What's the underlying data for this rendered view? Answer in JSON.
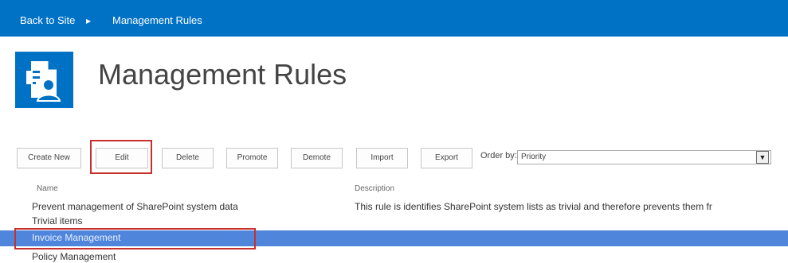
{
  "breadcrumb": {
    "back_label": "Back to Site",
    "separator": "▶",
    "current_label": "Management Rules"
  },
  "header": {
    "title": "Management Rules",
    "logo_icon": "management-rules-document-icon"
  },
  "toolbar": {
    "create_new": "Create New",
    "edit": "Edit",
    "delete": "Delete",
    "promote": "Promote",
    "demote": "Demote",
    "import": "Import",
    "export": "Export",
    "order_by_label": "Order by:",
    "order_by_value": "Priority",
    "dropdown_icon": "chevron-down-icon"
  },
  "table": {
    "columns": {
      "name": "Name",
      "description": "Description"
    },
    "rows": [
      {
        "name": "Prevent management of SharePoint system data",
        "description": "This rule is identifies SharePoint system lists as trivial and therefore prevents them fr"
      },
      {
        "name": "Trivial items",
        "description": ""
      },
      {
        "name": "Invoice Management",
        "description": ""
      },
      {
        "name": "Policy Management",
        "description": ""
      }
    ],
    "selected_row": "Invoice Management"
  },
  "colors": {
    "accent": "#0072c6",
    "selection": "#4f86dc",
    "highlight_box": "#c8302d"
  }
}
